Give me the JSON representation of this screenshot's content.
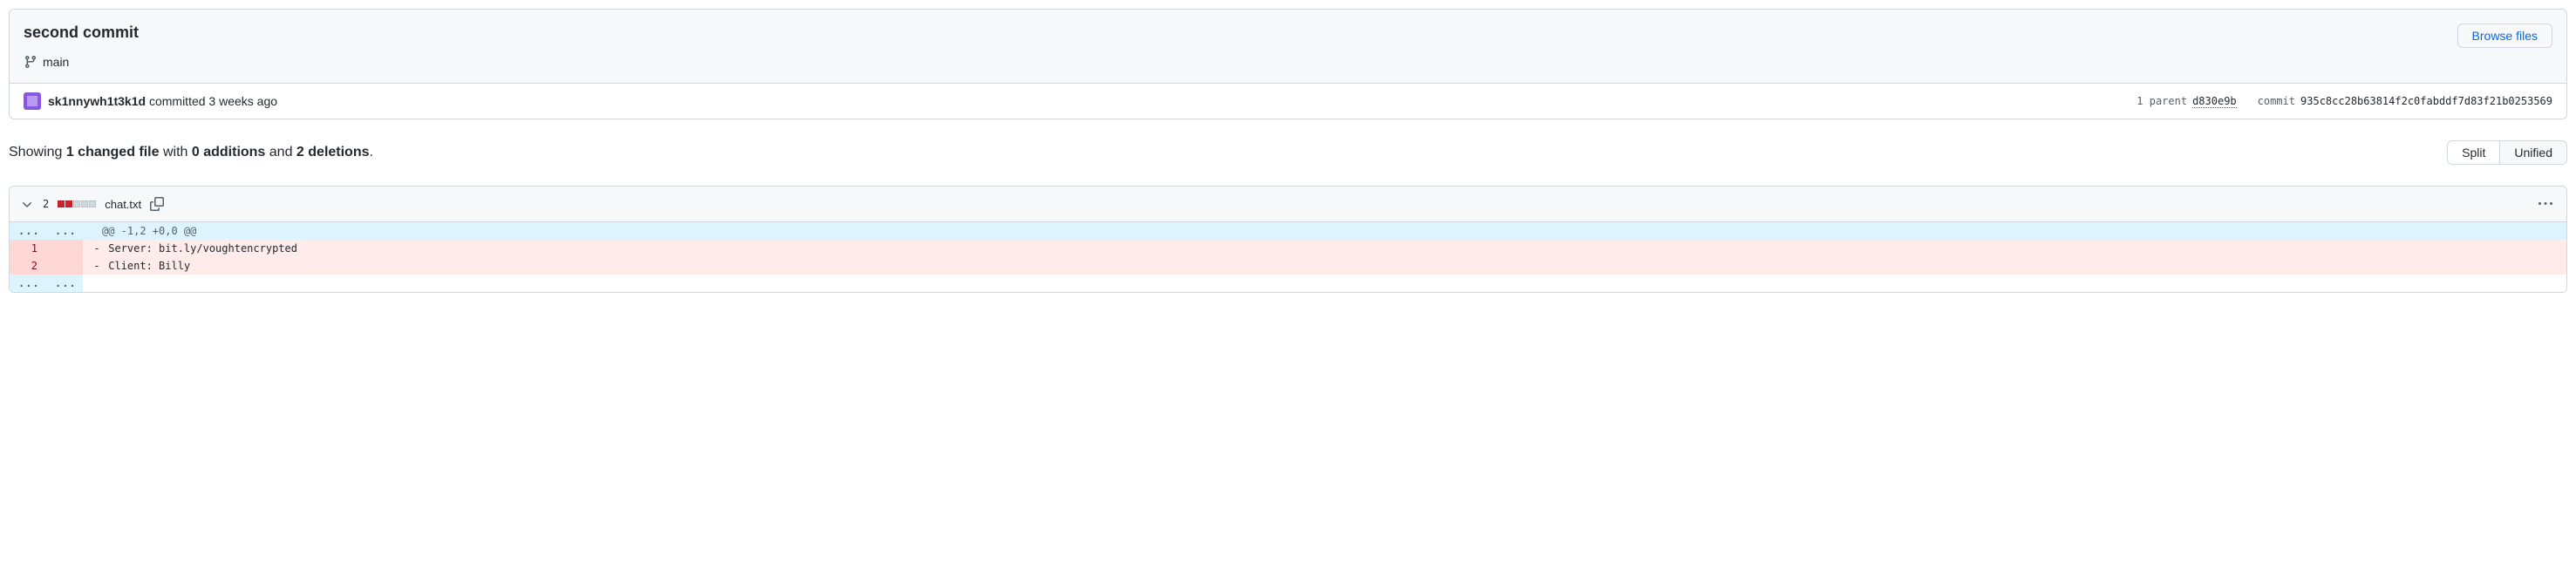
{
  "commit": {
    "title": "second commit",
    "branch": "main",
    "author": "sk1nnywh1t3k1d",
    "action_text": "committed",
    "relative_time": "3 weeks ago",
    "parent_label": "1 parent",
    "parent_sha": "d830e9b",
    "commit_label": "commit",
    "full_sha": "935c8cc28b63814f2c0fabddf7d83f21b0253569"
  },
  "browse_files_label": "Browse files",
  "diff_stats": {
    "prefix": "Showing ",
    "files": "1 changed file",
    "middle1": " with ",
    "additions": "0 additions",
    "middle2": " and ",
    "deletions": "2 deletions",
    "suffix": "."
  },
  "view_toggle": {
    "split": "Split",
    "unified": "Unified"
  },
  "file": {
    "change_count": "2",
    "name": "chat.txt",
    "hunk_header": "@@ -1,2 +0,0 @@",
    "lines": [
      {
        "num": "1",
        "marker": "-",
        "content": " Server: bit.ly/voughtencrypted"
      },
      {
        "num": "2",
        "marker": "-",
        "content": " Client: Billy"
      }
    ]
  }
}
